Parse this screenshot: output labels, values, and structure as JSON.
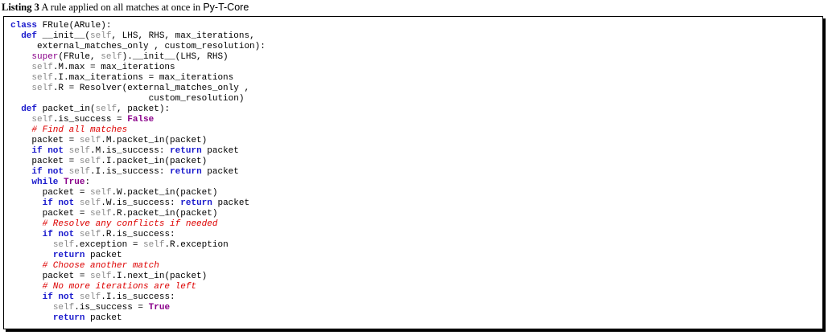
{
  "caption": {
    "label": "Listing 3",
    "text": "A rule applied on all matches at once in",
    "package": "Py-T-Core"
  },
  "code": {
    "lines": [
      {
        "indent": "",
        "tokens": [
          {
            "t": "kw",
            "v": "class"
          },
          {
            "t": "plain",
            "v": " FRule(ARule):"
          }
        ]
      },
      {
        "indent": "  ",
        "tokens": [
          {
            "t": "kw",
            "v": "def"
          },
          {
            "t": "plain",
            "v": " __init__("
          },
          {
            "t": "self",
            "v": "self"
          },
          {
            "t": "plain",
            "v": ", LHS, RHS, max_iterations,"
          }
        ]
      },
      {
        "indent": "     ",
        "tokens": [
          {
            "t": "plain",
            "v": "external_matches_only , custom_resolution):"
          }
        ]
      },
      {
        "indent": "    ",
        "tokens": [
          {
            "t": "builtin",
            "v": "super"
          },
          {
            "t": "plain",
            "v": "(FRule, "
          },
          {
            "t": "self",
            "v": "self"
          },
          {
            "t": "plain",
            "v": ").__init__(LHS, RHS)"
          }
        ]
      },
      {
        "indent": "    ",
        "tokens": [
          {
            "t": "self",
            "v": "self"
          },
          {
            "t": "plain",
            "v": ".M.max = max_iterations"
          }
        ]
      },
      {
        "indent": "    ",
        "tokens": [
          {
            "t": "self",
            "v": "self"
          },
          {
            "t": "plain",
            "v": ".I.max_iterations = max_iterations"
          }
        ]
      },
      {
        "indent": "    ",
        "tokens": [
          {
            "t": "self",
            "v": "self"
          },
          {
            "t": "plain",
            "v": ".R = Resolver(external_matches_only ,"
          }
        ]
      },
      {
        "indent": "                          ",
        "tokens": [
          {
            "t": "plain",
            "v": "custom_resolution)"
          }
        ]
      },
      {
        "indent": "  ",
        "tokens": [
          {
            "t": "kw",
            "v": "def"
          },
          {
            "t": "plain",
            "v": " packet_in("
          },
          {
            "t": "self",
            "v": "self"
          },
          {
            "t": "plain",
            "v": ", packet):"
          }
        ]
      },
      {
        "indent": "    ",
        "tokens": [
          {
            "t": "self",
            "v": "self"
          },
          {
            "t": "plain",
            "v": ".is_success = "
          },
          {
            "t": "const",
            "v": "False"
          }
        ]
      },
      {
        "indent": "    ",
        "tokens": [
          {
            "t": "comment",
            "v": "# Find all matches"
          }
        ]
      },
      {
        "indent": "    ",
        "tokens": [
          {
            "t": "plain",
            "v": "packet = "
          },
          {
            "t": "self",
            "v": "self"
          },
          {
            "t": "plain",
            "v": ".M.packet_in(packet)"
          }
        ]
      },
      {
        "indent": "    ",
        "tokens": [
          {
            "t": "kw",
            "v": "if not"
          },
          {
            "t": "plain",
            "v": " "
          },
          {
            "t": "self",
            "v": "self"
          },
          {
            "t": "plain",
            "v": ".M.is_success: "
          },
          {
            "t": "kw",
            "v": "return"
          },
          {
            "t": "plain",
            "v": " packet"
          }
        ]
      },
      {
        "indent": "    ",
        "tokens": [
          {
            "t": "plain",
            "v": "packet = "
          },
          {
            "t": "self",
            "v": "self"
          },
          {
            "t": "plain",
            "v": ".I.packet_in(packet)"
          }
        ]
      },
      {
        "indent": "    ",
        "tokens": [
          {
            "t": "kw",
            "v": "if not"
          },
          {
            "t": "plain",
            "v": " "
          },
          {
            "t": "self",
            "v": "self"
          },
          {
            "t": "plain",
            "v": ".I.is_success: "
          },
          {
            "t": "kw",
            "v": "return"
          },
          {
            "t": "plain",
            "v": " packet"
          }
        ]
      },
      {
        "indent": "    ",
        "tokens": [
          {
            "t": "kw",
            "v": "while"
          },
          {
            "t": "plain",
            "v": " "
          },
          {
            "t": "const",
            "v": "True"
          },
          {
            "t": "plain",
            "v": ":"
          }
        ]
      },
      {
        "indent": "      ",
        "tokens": [
          {
            "t": "plain",
            "v": "packet = "
          },
          {
            "t": "self",
            "v": "self"
          },
          {
            "t": "plain",
            "v": ".W.packet_in(packet)"
          }
        ]
      },
      {
        "indent": "      ",
        "tokens": [
          {
            "t": "kw",
            "v": "if not"
          },
          {
            "t": "plain",
            "v": " "
          },
          {
            "t": "self",
            "v": "self"
          },
          {
            "t": "plain",
            "v": ".W.is_success: "
          },
          {
            "t": "kw",
            "v": "return"
          },
          {
            "t": "plain",
            "v": " packet"
          }
        ]
      },
      {
        "indent": "      ",
        "tokens": [
          {
            "t": "plain",
            "v": "packet = "
          },
          {
            "t": "self",
            "v": "self"
          },
          {
            "t": "plain",
            "v": ".R.packet_in(packet)"
          }
        ]
      },
      {
        "indent": "      ",
        "tokens": [
          {
            "t": "comment",
            "v": "# Resolve any conflicts if needed"
          }
        ]
      },
      {
        "indent": "      ",
        "tokens": [
          {
            "t": "kw",
            "v": "if not"
          },
          {
            "t": "plain",
            "v": " "
          },
          {
            "t": "self",
            "v": "self"
          },
          {
            "t": "plain",
            "v": ".R.is_success:"
          }
        ]
      },
      {
        "indent": "        ",
        "tokens": [
          {
            "t": "self",
            "v": "self"
          },
          {
            "t": "plain",
            "v": ".exception = "
          },
          {
            "t": "self",
            "v": "self"
          },
          {
            "t": "plain",
            "v": ".R.exception"
          }
        ]
      },
      {
        "indent": "        ",
        "tokens": [
          {
            "t": "kw",
            "v": "return"
          },
          {
            "t": "plain",
            "v": " packet"
          }
        ]
      },
      {
        "indent": "      ",
        "tokens": [
          {
            "t": "comment",
            "v": "# Choose another match"
          }
        ]
      },
      {
        "indent": "      ",
        "tokens": [
          {
            "t": "plain",
            "v": "packet = "
          },
          {
            "t": "self",
            "v": "self"
          },
          {
            "t": "plain",
            "v": ".I.next_in(packet)"
          }
        ]
      },
      {
        "indent": "      ",
        "tokens": [
          {
            "t": "comment",
            "v": "# No more iterations are left"
          }
        ]
      },
      {
        "indent": "      ",
        "tokens": [
          {
            "t": "kw",
            "v": "if not"
          },
          {
            "t": "plain",
            "v": " "
          },
          {
            "t": "self",
            "v": "self"
          },
          {
            "t": "plain",
            "v": ".I.is_success:"
          }
        ]
      },
      {
        "indent": "        ",
        "tokens": [
          {
            "t": "self",
            "v": "self"
          },
          {
            "t": "plain",
            "v": ".is_success = "
          },
          {
            "t": "const",
            "v": "True"
          }
        ]
      },
      {
        "indent": "        ",
        "tokens": [
          {
            "t": "kw",
            "v": "return"
          },
          {
            "t": "plain",
            "v": " packet"
          }
        ]
      }
    ]
  },
  "colors": {
    "keyword": "#1a1acc",
    "builtin": "#8a008a",
    "self": "#8a8a8a",
    "comment": "#dd0000"
  }
}
